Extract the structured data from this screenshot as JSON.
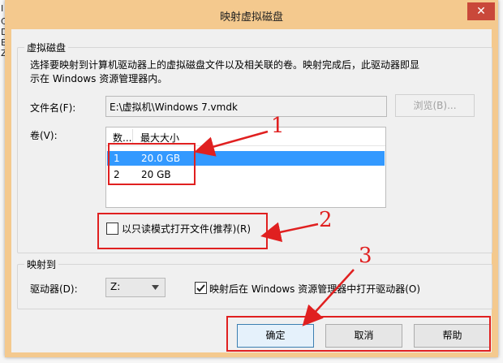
{
  "background": {
    "lines": [
      "I",
      "C",
      "D",
      "E",
      "Z"
    ]
  },
  "dialog": {
    "title": "映射虚拟磁盘",
    "close_glyph": "✕",
    "vdisk_group": {
      "title": "虚拟磁盘",
      "description_line1": "选择要映射到计算机驱动器上的虚拟磁盘文件以及相关联的卷。映射完成后，此驱动器即显",
      "description_line2": "示在 Windows 资源管理器内。",
      "filename_label": "文件名(F):",
      "filename_value": "E:\\虚拟机\\Windows 7.vmdk",
      "browse_label": "浏览(B)...",
      "volume_label": "卷(V):",
      "columns": [
        "数...",
        "最大大小"
      ],
      "rows": [
        {
          "num": "1",
          "size": "20.0 GB",
          "selected": true
        },
        {
          "num": "2",
          "size": "20 GB",
          "selected": false
        }
      ],
      "readonly_label": "以只读模式打开文件(推荐)(R)",
      "readonly_checked": false
    },
    "map_group": {
      "title": "映射到",
      "drive_label": "驱动器(D):",
      "drive_value": "Z:",
      "open_explorer_label": "映射后在 Windows 资源管理器中打开驱动器(O)",
      "open_explorer_checked": true
    },
    "buttons": {
      "ok": "确定",
      "cancel": "取消",
      "help": "帮助"
    }
  },
  "annotations": [
    "1",
    "2",
    "3"
  ],
  "colors": {
    "titlebar": "#f4c98e",
    "selection": "#3399ff",
    "annotation": "#e02020"
  }
}
